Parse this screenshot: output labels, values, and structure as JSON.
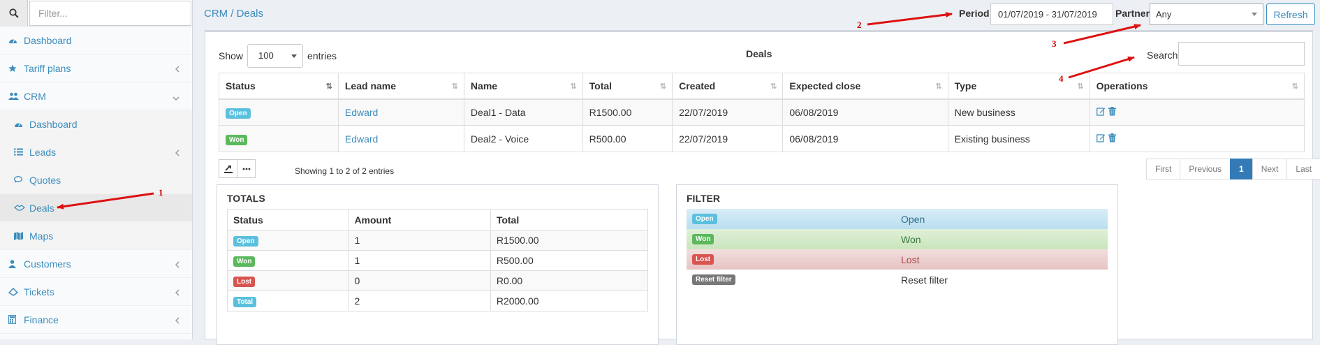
{
  "sidebar": {
    "search_placeholder": "Filter...",
    "items": [
      {
        "label": "Dashboard",
        "icon": "dashboard-icon"
      },
      {
        "label": "Tariff plans",
        "icon": "star-icon"
      },
      {
        "label": "CRM",
        "icon": "users-icon"
      },
      {
        "label": "Dashboard",
        "icon": "dashboard-icon"
      },
      {
        "label": "Leads",
        "icon": "list-icon"
      },
      {
        "label": "Quotes",
        "icon": "comments-icon"
      },
      {
        "label": "Deals",
        "icon": "handshake-icon"
      },
      {
        "label": "Maps",
        "icon": "map-icon"
      },
      {
        "label": "Customers",
        "icon": "user-icon"
      },
      {
        "label": "Tickets",
        "icon": "ticket-icon"
      },
      {
        "label": "Finance",
        "icon": "calculator-icon"
      }
    ]
  },
  "header": {
    "breadcrumb": "CRM / Deals",
    "period_label": "Period",
    "period_value": "01/07/2019 - 31/07/2019",
    "partner_label": "Partner",
    "partner_value": "Any",
    "refresh_label": "Refresh"
  },
  "deals": {
    "show_label": "Show",
    "entries_value": "100",
    "entries_label": "entries",
    "title": "Deals",
    "search_label": "Search:",
    "columns": [
      "Status",
      "Lead name",
      "Name",
      "Total",
      "Created",
      "Expected close",
      "Type",
      "Operations"
    ],
    "rows": [
      {
        "status": "Open",
        "lead": "Edward",
        "name": "Deal1 - Data",
        "total": "R1500.00",
        "created": "22/07/2019",
        "close": "06/08/2019",
        "type": "New business"
      },
      {
        "status": "Won",
        "lead": "Edward",
        "name": "Deal2 - Voice",
        "total": "R500.00",
        "created": "22/07/2019",
        "close": "06/08/2019",
        "type": "Existing business"
      }
    ],
    "info": "Showing 1 to 2 of 2 entries",
    "pagination": [
      "First",
      "Previous",
      "1",
      "Next",
      "Last"
    ]
  },
  "totals": {
    "title": "TOTALS",
    "columns": [
      "Status",
      "Amount",
      "Total"
    ],
    "rows": [
      {
        "status": "Open",
        "amount": "1",
        "total": "R1500.00"
      },
      {
        "status": "Won",
        "amount": "1",
        "total": "R500.00"
      },
      {
        "status": "Lost",
        "amount": "0",
        "total": "R0.00"
      },
      {
        "status": "Total",
        "amount": "2",
        "total": "R2000.00"
      }
    ]
  },
  "filter": {
    "title": "FILTER",
    "rows": [
      {
        "badge": "Open",
        "label": "Open"
      },
      {
        "badge": "Won",
        "label": "Won"
      },
      {
        "badge": "Lost",
        "label": "Lost"
      },
      {
        "badge": "Reset filter",
        "label": "Reset filter"
      }
    ]
  },
  "annotations": [
    "1",
    "2",
    "3",
    "4"
  ],
  "colors": {
    "link": "#3c8dbc",
    "open": "#5bc0de",
    "won": "#5cb85c",
    "lost": "#d9534f",
    "arrow": "#dd1111"
  }
}
